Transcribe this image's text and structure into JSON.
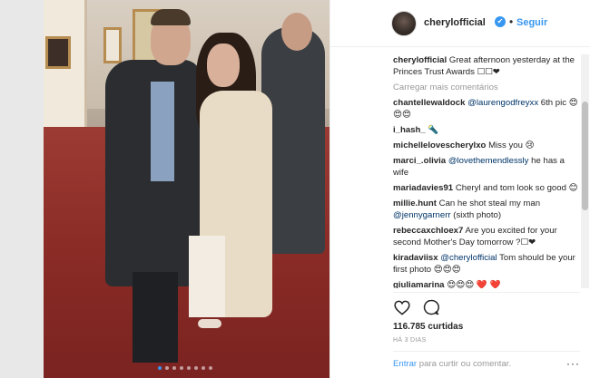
{
  "post": {
    "username": "cherylofficial",
    "verified_glyph": "✔",
    "separator": "•",
    "follow_label": "Seguir",
    "caption_text": "Great afternoon yesterday at the Princes Trust Awards ☐☐❤",
    "load_more": "Carregar mais comentários",
    "likes": "116.785 curtidas",
    "time": "HÁ 3 DIAS",
    "login_link": "Entrar",
    "login_text": " para curtir ou comentar.",
    "more_options": "···",
    "carousel_count": 8,
    "carousel_active_index": 0
  },
  "comments": [
    {
      "user": "chantellewaldock",
      "mention": "@laurengodfreyxx",
      "text": " 6th pic 😍😍😍"
    },
    {
      "user": "i_hash_",
      "mention": "",
      "text": "🔦"
    },
    {
      "user": "michellelovescherylxo",
      "mention": "",
      "text": "Miss you 😢"
    },
    {
      "user": "marci_.olivia",
      "mention": "@lovethemendlessly",
      "text": " he has a wife"
    },
    {
      "user": "mariadavies91",
      "mention": "",
      "text": "Cheryl and tom look so good 😊"
    },
    {
      "user": "millie.hunt",
      "mention": "",
      "text": "Can he shot steal my man ",
      "mention2": "@jennygarnerr",
      "text2": " (sixth photo)"
    },
    {
      "user": "rebeccaxchloex7",
      "mention": "",
      "text": "Are you excited for your second Mother's Day tomorrow ?☐❤"
    },
    {
      "user": "kiradaviisx",
      "mention": "@cherylofficial",
      "text": " Tom should be your first photo 😍😍😍"
    },
    {
      "user": "giuliamarina",
      "mention": "",
      "text": "😍😍😍 ❤️ ❤️"
    }
  ],
  "colors": {
    "accent": "#3897f0",
    "muted": "#999999",
    "text": "#262626"
  },
  "icons": {
    "like": "heart-icon",
    "comment": "comment-bubble-icon",
    "verified": "verified-badge-icon",
    "more": "more-options-icon"
  }
}
